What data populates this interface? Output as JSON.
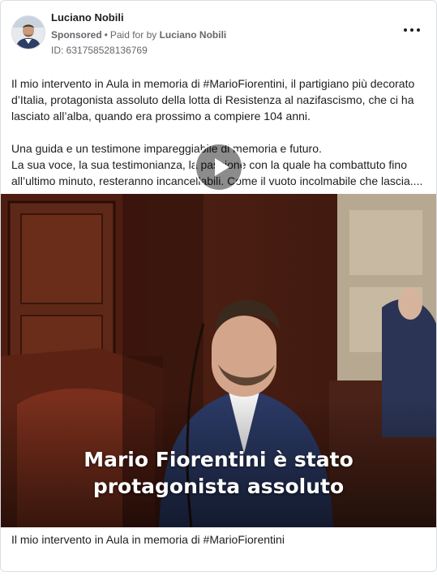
{
  "advertiser": {
    "name": "Luciano Nobili",
    "sponsored_label": "Sponsored",
    "paid_for_prefix": "Paid for by",
    "paid_for_name": "Luciano Nobili",
    "ad_id": "ID: 631758528136769",
    "more_icon": "more-horizontal-icon"
  },
  "post": {
    "paragraphs": [
      [
        "Il mio intervento in Aula in memoria di #MarioFiorentini, il partigiano più decorato",
        "d’Italia, protagonista assoluto della lotta di Resistenza al nazifascismo, che ci ha",
        "lasciato all’alba, quando era prossimo a compiere 104 anni."
      ],
      [
        "Una guida e un testimone impareggiabile di memoria e futuro.",
        "La sua voce, la sua testimonianza, la passione con la quale ha combattuto fino",
        "all’ultimo minuto, resteranno incancellabili. Come il vuoto incolmabile che lascia...."
      ]
    ]
  },
  "video": {
    "overlay_lines": [
      "Mario Fiorentini è stato",
      "protagonista assoluto"
    ],
    "play_icon": "play-icon",
    "caption": "Il mio intervento in Aula in memoria di #MarioFiorentini"
  },
  "colors": {
    "text": "#1c1e21",
    "secondary": "#65676b",
    "border": "#dadde1"
  }
}
